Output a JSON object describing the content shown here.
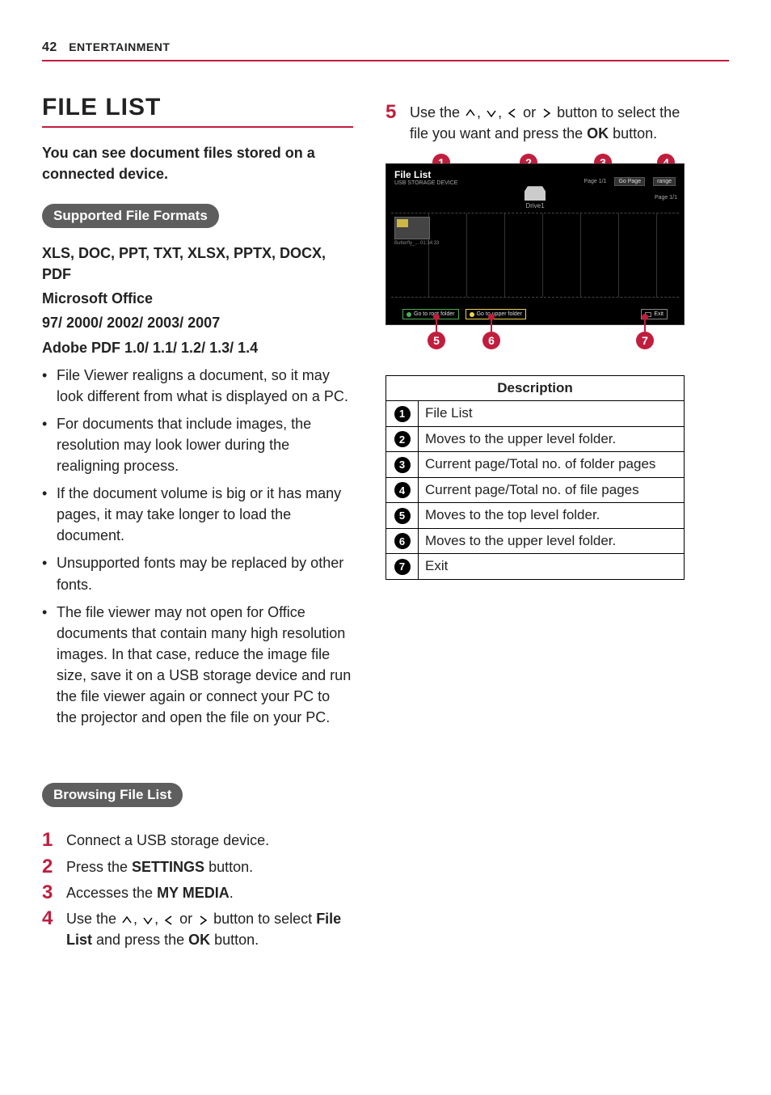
{
  "page": {
    "number": "42",
    "section": "ENTERTAINMENT"
  },
  "title": "FILE LIST",
  "intro": "You can see document files stored on a connected device.",
  "supported": {
    "heading": "Supported File Formats",
    "line1": "XLS, DOC, PPT, TXT, XLSX, PPTX, DOCX, PDF",
    "line2": "Microsoft Office",
    "line3": "97/ 2000/ 2002/ 2003/ 2007",
    "line4": "Adobe PDF 1.0/ 1.1/ 1.2/ 1.3/ 1.4"
  },
  "notes": [
    "File Viewer realigns a document, so it may look different from what is displayed on a PC.",
    "For documents that include images, the resolution may look lower during the realigning process.",
    "If the document volume is big or it has many pages, it may take longer to load the document.",
    "Unsupported fonts may be replaced by other fonts.",
    "The file viewer may not open for Office documents that contain many high resolution images. In that case, reduce the image file size, save it on a USB storage device and run the file viewer again or connect your PC to the projector and open the file on your PC."
  ],
  "browsing": {
    "heading": "Browsing File List",
    "steps": {
      "s1": "Connect a USB storage device.",
      "s2_pre": "Press the ",
      "s2_bold": "SETTINGS",
      "s2_post": " button.",
      "s3_pre": "Accesses the ",
      "s3_bold": "MY MEDIA",
      "s3_post": ".",
      "s4_pre": "Use the ",
      "s4_mid": " or ",
      "s4_post": " button to select ",
      "s4_bold": "File List",
      "s4_post2": " and press the ",
      "s4_bold2": "OK",
      "s4_post3": " button.",
      "s5_pre": "Use the ",
      "s5_mid": " or ",
      "s5_post": " button to select the file you want and press the ",
      "s5_bold": "OK",
      "s5_post2": " button."
    }
  },
  "shot": {
    "title": "File List",
    "subtitle": "USB STORAGE DEVICE",
    "drive": "Drive1",
    "page_folder": "Page 1/1",
    "page_file": "Page 1/1",
    "go_page": "Go Page",
    "change": "range",
    "btn_root": "Go to root folder",
    "btn_upper": "Go to upper folder",
    "btn_exit": "Exit",
    "thumb_label": "Butterfly_...\n01:34:33"
  },
  "table": {
    "header": "Description",
    "rows": [
      "File List",
      "Moves to the upper level folder.",
      "Current page/Total no. of folder pages",
      "Current page/Total no. of file pages",
      "Moves to the top level folder.",
      "Moves to the upper level folder.",
      "Exit"
    ]
  }
}
